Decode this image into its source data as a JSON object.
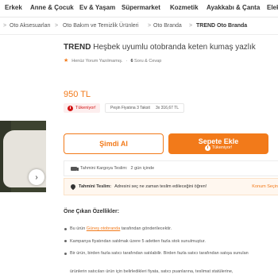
{
  "nav": {
    "items": [
      "Erkek",
      "Anne & Çocuk",
      "Ev & Yaşam",
      "Süpermarket",
      "Kozmetik",
      "Ayakkabı & Çanta",
      "Elek"
    ]
  },
  "breadcrumb": {
    "items": [
      "Oto Aksesuarları",
      "Oto Bakım ve Temizlik Ürünleri",
      "Oto Branda",
      "TREND Oto Branda"
    ],
    "separator": ">"
  },
  "product": {
    "brand": "TREND",
    "name": "Heşbek uyumlu otobranda keten kumaş yazlık",
    "review_text": "Henüz Yorum Yazılmamış.",
    "qa_count": "6",
    "qa_label": "Soru & Cevap",
    "price": "950 TL",
    "stock_badge": "Tükeniyor!",
    "installment_label": "Peşin Fiyatına 3 Taksit",
    "installment_value": "3x 316,67 TL"
  },
  "actions": {
    "buy_now": "Şimdi Al",
    "add_to_cart": "Sepete Ekle",
    "add_to_cart_sub": "Tükeniyor!"
  },
  "shipping": {
    "cargo_label": "Tahmini Kargoya Teslim:",
    "cargo_value": "2 gün içinde",
    "delivery_label": "Tahmini Teslim:",
    "delivery_value": "Adresini seç ne zaman teslim edileceğini öğren!",
    "store_link": "Konum Seçin"
  },
  "features": {
    "title": "Öne Çıkan Özellikler:",
    "items": [
      {
        "prefix": "Bu ürün ",
        "link": "Güneş otobranda",
        "suffix": " tarafından gönderilecektir."
      },
      {
        "text": "Kampanya fiyatından satılmak üzere 5 adetten fazla stok sunulmuştur."
      },
      {
        "text": "Bir ürün, birden fazla satıcı tarafından satılabilir. Birden fazla satıcı tarafından satışa sunulan"
      }
    ],
    "continuation": "ürünlerin satıcıları ürün için belirledikleri fiyata, satıcı puanlarına, teslimat statülerine,"
  },
  "colors": {
    "accent": "#f27a1a",
    "danger": "#d21313"
  }
}
